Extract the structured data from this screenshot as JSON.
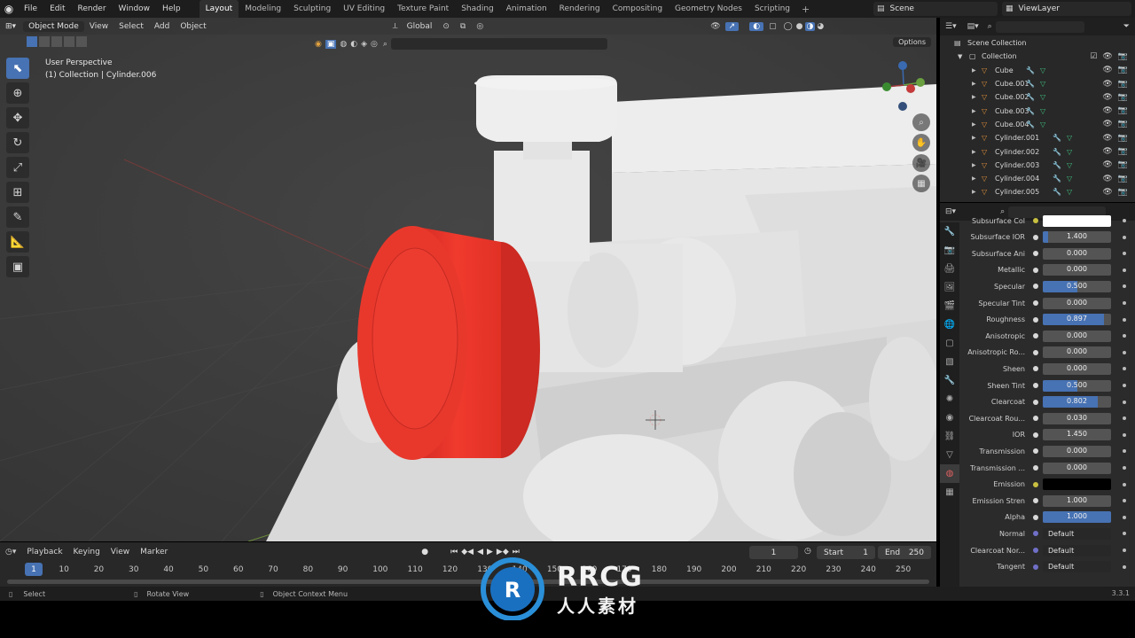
{
  "menubar": {
    "items": [
      "File",
      "Edit",
      "Render",
      "Window",
      "Help"
    ],
    "workspaces": [
      "Layout",
      "Modeling",
      "Sculpting",
      "UV Editing",
      "Texture Paint",
      "Shading",
      "Animation",
      "Rendering",
      "Compositing",
      "Geometry Nodes",
      "Scripting"
    ],
    "active_workspace": "Layout",
    "scene": "Scene",
    "view_layer": "ViewLayer"
  },
  "viewport": {
    "mode": "Object Mode",
    "menus": [
      "View",
      "Select",
      "Add",
      "Object"
    ],
    "transform_orientation": "Global",
    "perspective_label": "User Perspective",
    "object_label": "(1) Collection | Cylinder.006",
    "options_label": "Options"
  },
  "outliner": {
    "root": "Scene Collection",
    "collection": "Collection",
    "objects": [
      "Cube",
      "Cube.001",
      "Cube.002",
      "Cube.003",
      "Cube.004",
      "Cylinder.001",
      "Cylinder.002",
      "Cylinder.003",
      "Cylinder.004",
      "Cylinder.005"
    ]
  },
  "properties": {
    "rows": [
      {
        "label": "Subsurface Col",
        "type": "color",
        "color": "#ffffff"
      },
      {
        "label": "Subsurface IOR",
        "type": "slider",
        "value": "1.400",
        "fill": 0.08
      },
      {
        "label": "Subsurface Ani",
        "type": "slider",
        "value": "0.000",
        "fill": 0
      },
      {
        "label": "Metallic",
        "type": "slider",
        "value": "0.000",
        "fill": 0
      },
      {
        "label": "Specular",
        "type": "slider",
        "value": "0.500",
        "fill": 0.5
      },
      {
        "label": "Specular Tint",
        "type": "slider",
        "value": "0.000",
        "fill": 0
      },
      {
        "label": "Roughness",
        "type": "slider",
        "value": "0.897",
        "fill": 0.897
      },
      {
        "label": "Anisotropic",
        "type": "slider",
        "value": "0.000",
        "fill": 0
      },
      {
        "label": "Anisotropic Ro...",
        "type": "slider",
        "value": "0.000",
        "fill": 0
      },
      {
        "label": "Sheen",
        "type": "slider",
        "value": "0.000",
        "fill": 0
      },
      {
        "label": "Sheen Tint",
        "type": "slider",
        "value": "0.500",
        "fill": 0.5
      },
      {
        "label": "Clearcoat",
        "type": "slider",
        "value": "0.802",
        "fill": 0.802
      },
      {
        "label": "Clearcoat Rou...",
        "type": "slider",
        "value": "0.030",
        "fill": 0
      },
      {
        "label": "IOR",
        "type": "slider",
        "value": "1.450",
        "fill": 0
      },
      {
        "label": "Transmission",
        "type": "slider",
        "value": "0.000",
        "fill": 0
      },
      {
        "label": "Transmission ...",
        "type": "slider",
        "value": "0.000",
        "fill": 0
      },
      {
        "label": "Emission",
        "type": "color",
        "color": "#000000"
      },
      {
        "label": "Emission Stren",
        "type": "slider",
        "value": "1.000",
        "fill": 0
      },
      {
        "label": "Alpha",
        "type": "slider",
        "value": "1.000",
        "fill": 1
      },
      {
        "label": "Normal",
        "type": "select",
        "value": "Default"
      },
      {
        "label": "Clearcoat Nor...",
        "type": "select",
        "value": "Default"
      },
      {
        "label": "Tangent",
        "type": "select",
        "value": "Default"
      }
    ]
  },
  "timeline": {
    "menus": [
      "Playback",
      "Keying",
      "View",
      "Marker"
    ],
    "current_frame": "1",
    "start_label": "Start",
    "start": "1",
    "end_label": "End",
    "end": "250",
    "ticks": [
      "1",
      "10",
      "20",
      "30",
      "40",
      "50",
      "60",
      "70",
      "80",
      "90",
      "100",
      "110",
      "120",
      "130",
      "140",
      "150",
      "160",
      "170",
      "180",
      "190",
      "200",
      "210",
      "220",
      "230",
      "240",
      "250"
    ]
  },
  "statusbar": {
    "select": "Select",
    "rotate": "Rotate View",
    "context": "Object Context Menu",
    "version": "3.3.1"
  },
  "watermark": {
    "logo_text": "RRCG",
    "sub_text": "人人素材"
  },
  "colors": {
    "accent": "#4772b3",
    "red_object": "#e8352a",
    "viewport_bg": "#3d3d3d"
  }
}
